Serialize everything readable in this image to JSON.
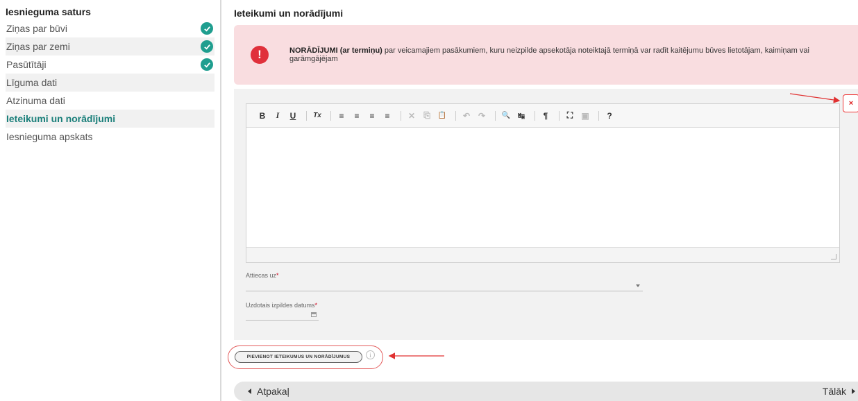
{
  "sidebar": {
    "title": "Iesnieguma saturs",
    "items": [
      {
        "label": "Ziņas par būvi",
        "done": true
      },
      {
        "label": "Ziņas par zemi",
        "done": true
      },
      {
        "label": "Pasūtītāji",
        "done": true
      },
      {
        "label": "Līguma dati",
        "done": false
      },
      {
        "label": "Atzinuma dati",
        "done": false
      },
      {
        "label": "Ieteikumi un norādījumi",
        "done": false,
        "active": true
      },
      {
        "label": "Iesnieguma apskats",
        "done": false
      }
    ]
  },
  "main": {
    "title": "Ieteikumi un norādījumi",
    "alert": {
      "icon": "exclamation-icon",
      "bold": "NORĀDĪJUMI (ar termiņu)",
      "text": " par veicamajiem pasākumiem, kuru neizpilde apsekotāja noteiktajā termiņā var radīt kaitējumu būves lietotājam, kaimiņam vai garāmgājējam"
    },
    "toolbar": [
      "B",
      "I",
      "U",
      "Tx",
      "≡",
      "≡",
      "≡",
      "≡",
      "✕",
      "⎘",
      "📋",
      "↶",
      "↷",
      "🔍",
      "↹",
      "¶",
      "⛶",
      "▣",
      "?"
    ],
    "fields": {
      "applies_label": "Attiecas uz",
      "applies_value": "",
      "due_date_label": "Uzdotais izpildes datums",
      "due_date_value": "",
      "required_mark": "*"
    },
    "close_label": "×",
    "add_button": "PIEVIENOT IETEIKUMUS UN NORĀDĪJUMUS",
    "info_label": "i",
    "back_label": "Atpakaļ",
    "next_label": "Tālāk"
  },
  "colors": {
    "accent": "#1f9e8f",
    "alert_bg": "#f9dde0",
    "danger": "#e0303b"
  }
}
